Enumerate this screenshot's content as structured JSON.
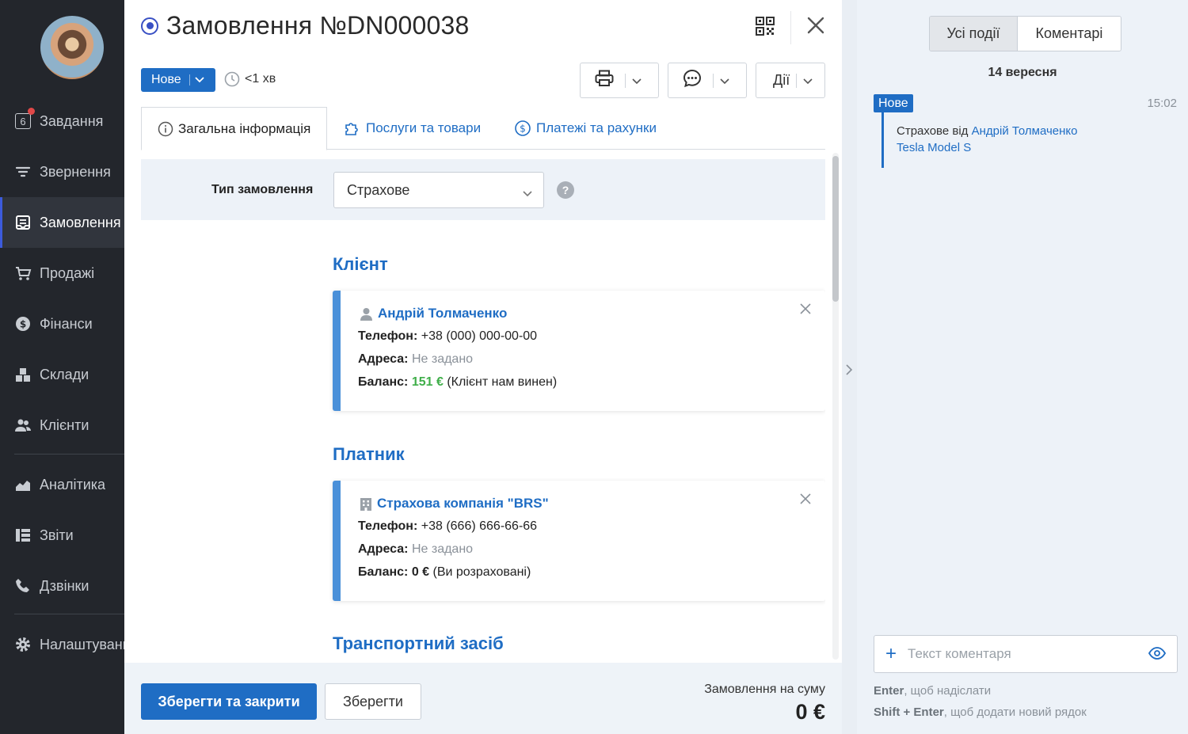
{
  "sidebar": {
    "items": [
      {
        "label": "Завдання",
        "icon": "tasks-icon",
        "badge": "6"
      },
      {
        "label": "Звернення",
        "icon": "filter-icon"
      },
      {
        "label": "Замовлення",
        "icon": "orders-icon",
        "active": true
      },
      {
        "label": "Продажі",
        "icon": "cart-icon"
      },
      {
        "label": "Фінанси",
        "icon": "dollar-icon"
      },
      {
        "label": "Склади",
        "icon": "boxes-icon"
      },
      {
        "label": "Клієнти",
        "icon": "users-icon"
      },
      {
        "label": "Аналітика",
        "icon": "chart-icon"
      },
      {
        "label": "Звіти",
        "icon": "reports-icon"
      },
      {
        "label": "Дзвінки",
        "icon": "phone-icon"
      },
      {
        "label": "Налаштування",
        "icon": "gear-icon"
      }
    ]
  },
  "order": {
    "title": "Замовлення №DN000038",
    "status": "Нове",
    "elapsed": "<1 хв",
    "actions_label": "Дії"
  },
  "tabs": [
    {
      "label": "Загальна інформація",
      "icon": "info-icon"
    },
    {
      "label": "Послуги та товари",
      "icon": "puzzle-icon"
    },
    {
      "label": "Платежі та рахунки",
      "icon": "dollar-icon"
    }
  ],
  "order_type": {
    "label": "Тип замовлення",
    "value": "Страхове"
  },
  "client": {
    "section_title": "Клієнт",
    "name": "Андрій Толмаченко",
    "phone_label": "Телефон:",
    "phone": "+38 (000) 000-00-00",
    "address_label": "Адреса:",
    "address": "Не задано",
    "balance_label": "Баланс:",
    "balance": "151 €",
    "balance_note": "(Клієнт нам винен)"
  },
  "payer": {
    "section_title": "Платник",
    "name": "Страхова компанія \"BRS\"",
    "phone_label": "Телефон:",
    "phone": "+38 (666) 666-66-66",
    "address_label": "Адреса:",
    "address": "Не задано",
    "balance_label": "Баланс:",
    "balance": "0 €",
    "balance_note": "(Ви розраховані)"
  },
  "vehicle": {
    "section_title": "Транспортний засіб"
  },
  "footer": {
    "save_close": "Зберегти та закрити",
    "save": "Зберегти",
    "sum_label": "Замовлення на суму",
    "sum_value": "0 €"
  },
  "events": {
    "tab_all": "Усі події",
    "tab_comments": "Коментарі",
    "date": "14 вересня",
    "entry": {
      "badge": "Нове",
      "time": "15:02",
      "text_prefix": "Страхове від",
      "client_link": "Андрій Толмаченко",
      "vehicle_link": "Tesla Model S"
    },
    "comment_placeholder": "Текст коментаря",
    "hint1_key": "Enter",
    "hint1_text": ", щоб надіслати",
    "hint2_key": "Shift + Enter",
    "hint2_text": ", щоб додати новий рядок"
  },
  "colors": {
    "accent": "#1f6dc4",
    "sidebar_bg": "#23262c",
    "positive": "#3fae49",
    "card_border": "#4a90d9"
  }
}
